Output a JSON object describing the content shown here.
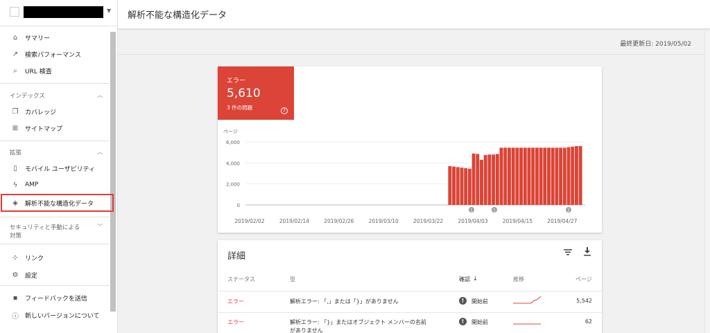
{
  "header": {
    "title": "解析不能な構造化データ"
  },
  "last_updated": "最終更新日: 2019/05/02",
  "sidebar": {
    "items_top": [
      {
        "label": "サマリー",
        "icon": "home-icon"
      },
      {
        "label": "検索パフォーマンス",
        "icon": "trending-up-icon"
      },
      {
        "label": "URL 検査",
        "icon": "search-icon"
      }
    ],
    "section_index": "インデックス",
    "items_index": [
      {
        "label": "カバレッジ",
        "icon": "file-copy-icon"
      },
      {
        "label": "サイトマップ",
        "icon": "sitemap-icon"
      }
    ],
    "section_enhancements": "拡張",
    "items_enhancements": [
      {
        "label": "モバイル ユーザビリティ",
        "icon": "smartphone-icon"
      },
      {
        "label": "AMP",
        "icon": "bolt-icon"
      },
      {
        "label": "解析不能な構造化データ",
        "icon": "layers-icon"
      }
    ],
    "section_security_line1": "セキュリティと手動による",
    "section_security_line2": "対策",
    "items_bottom": [
      {
        "label": "リンク",
        "icon": "links-icon"
      },
      {
        "label": "設定",
        "icon": "gear-icon"
      }
    ],
    "items_footer": [
      {
        "label": "フィードバックを送信",
        "icon": "feedback-icon"
      },
      {
        "label": "新しいバージョンについて",
        "icon": "info-icon"
      }
    ]
  },
  "error_tile": {
    "label": "エラー",
    "count": "5,610",
    "issues": "3 件の問題",
    "help": "?"
  },
  "chart_data": {
    "type": "bar",
    "ylabel": "ページ",
    "ylim": [
      0,
      6000
    ],
    "y_ticks": [
      "0",
      "2,000",
      "4,000",
      "6,000"
    ],
    "x_tick_labels": [
      "2019/02/02",
      "2019/02/14",
      "2019/02/26",
      "2019/03/10",
      "2019/03/22",
      "2019/04/03",
      "2019/04/15",
      "2019/04/27"
    ],
    "color": "#db4437",
    "values": [
      3700,
      3650,
      3600,
      3550,
      3500,
      3450,
      4900,
      4850,
      4300,
      4750,
      4800,
      4800,
      4850,
      5450,
      5450,
      5450,
      5450,
      5450,
      5450,
      5450,
      5450,
      5450,
      5450,
      5450,
      5450,
      5450,
      5450,
      5450,
      5450,
      5450,
      5500,
      5550,
      5600,
      5610
    ],
    "annotations": [
      "1",
      "1",
      "2"
    ]
  },
  "details": {
    "title": "詳細",
    "columns": [
      "ステータス",
      "型",
      "確認",
      "推移",
      "ページ"
    ],
    "sort_arrow": "↓",
    "rows": [
      {
        "status": "エラー",
        "type": "解析エラー: 「,」または「}」がありません",
        "type2": "",
        "check": "開始前",
        "pages": "5,542"
      },
      {
        "status": "エラー",
        "type": "解析エラー: 「}」またはオブジェクト メンバーの名前",
        "type2": "がありません",
        "check": "開始前",
        "pages": "62"
      }
    ]
  }
}
